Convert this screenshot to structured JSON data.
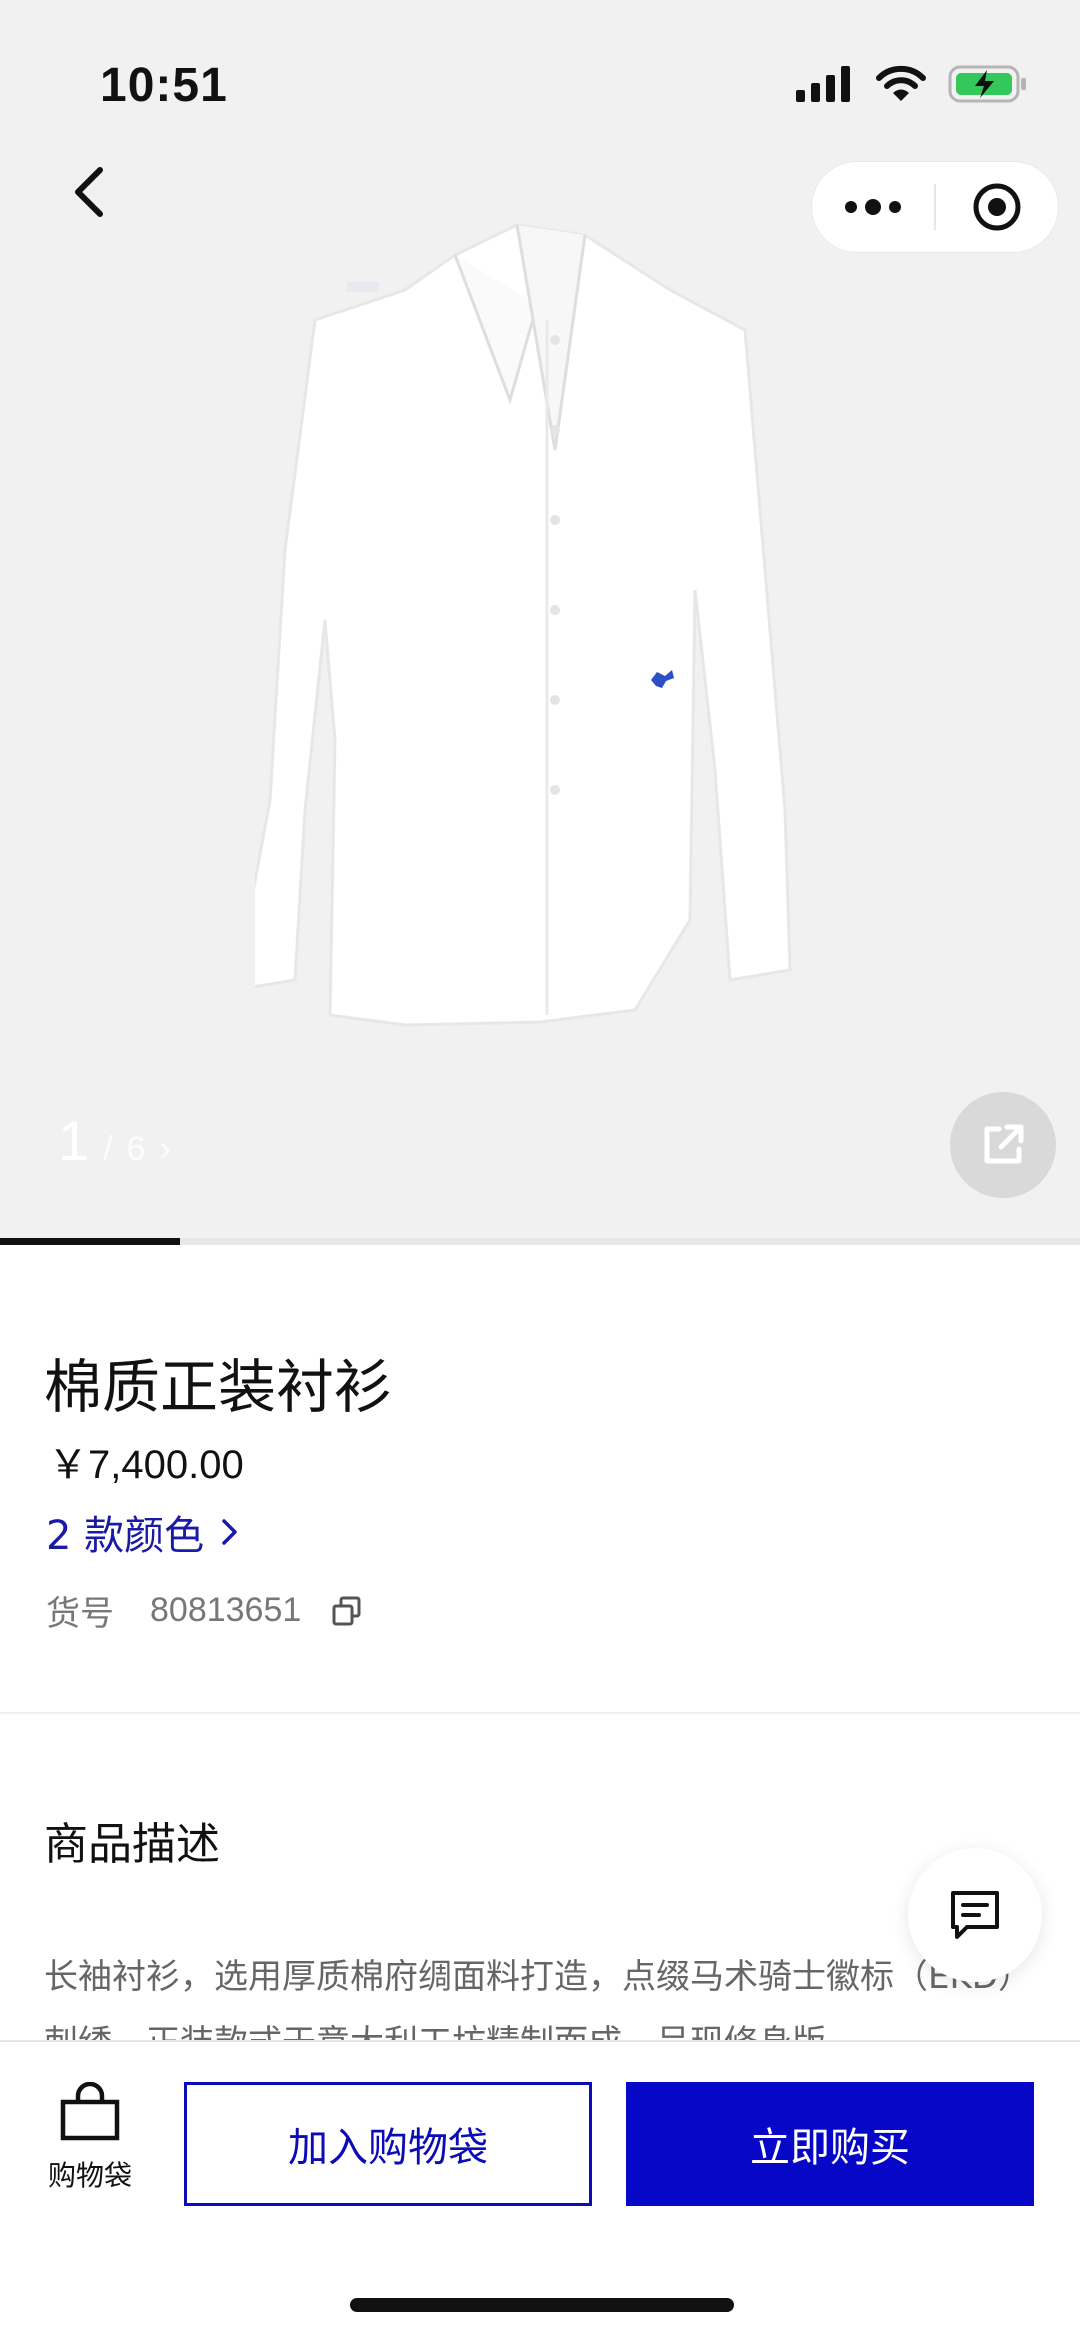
{
  "status_bar": {
    "time": "10:51",
    "battery_color": "#34c759"
  },
  "gallery": {
    "current": "1",
    "separator": "/",
    "total": "6",
    "arrow": "›",
    "progress": 0.1667,
    "logo_color": "#2b4fc4"
  },
  "product": {
    "title": "棉质正装衬衫",
    "price": "￥7,400.00",
    "colors_label": "2 款颜色",
    "sku_label": "货号",
    "sku_value": "80813651"
  },
  "description": {
    "heading": "商品描述",
    "text": "长袖衬衫，选用厚质棉府绸面料打造，点缀马术骑士徽标（EKD）刺绣。正装款式于意大利工坊精制而成，呈现修身版"
  },
  "bottom_bar": {
    "bag_label": "购物袋",
    "add_label": "加入购物袋",
    "buy_label": "立即购买",
    "accent": "#0707c7"
  },
  "icons": [
    "back-icon",
    "more-icon",
    "target-icon",
    "share-icon",
    "copy-icon",
    "chat-icon",
    "bag-icon",
    "signal-icon",
    "wifi-icon",
    "battery-icon"
  ]
}
